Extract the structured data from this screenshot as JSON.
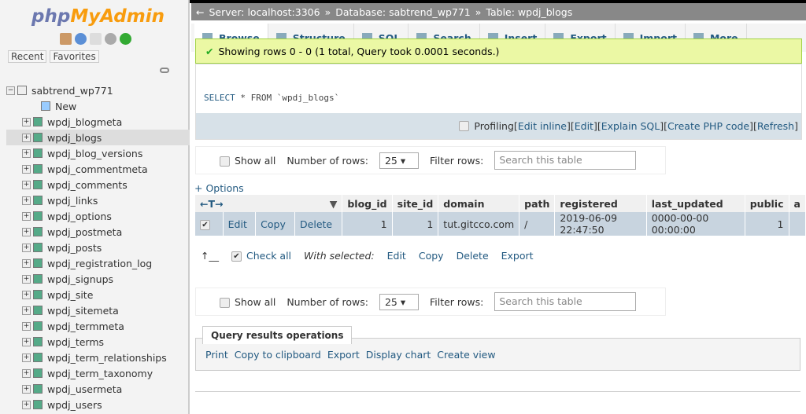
{
  "sidebar": {
    "logo_a": "php",
    "logo_b": "MyAdmin",
    "recent": "Recent",
    "favorites": "Favorites",
    "db": "sabtrend_wp771",
    "new": "New",
    "tables": [
      "wpdj_blogmeta",
      "wpdj_blogs",
      "wpdj_blog_versions",
      "wpdj_commentmeta",
      "wpdj_comments",
      "wpdj_links",
      "wpdj_options",
      "wpdj_postmeta",
      "wpdj_posts",
      "wpdj_registration_log",
      "wpdj_signups",
      "wpdj_site",
      "wpdj_sitemeta",
      "wpdj_termmeta",
      "wpdj_terms",
      "wpdj_term_relationships",
      "wpdj_term_taxonomy",
      "wpdj_usermeta",
      "wpdj_users"
    ],
    "selected": "wpdj_blogs"
  },
  "breadcrumb": {
    "server": "Server: localhost:3306",
    "database": "Database: sabtrend_wp771",
    "table": "Table: wpdj_blogs"
  },
  "tabs": [
    "Browse",
    "Structure",
    "SQL",
    "Search",
    "Insert",
    "Export",
    "Import",
    "More"
  ],
  "message": "Showing rows 0 - 0 (1 total, Query took 0.0001 seconds.)",
  "sql": {
    "select": "SELECT",
    "rest": " * FROM ",
    "table": "`wpdj_blogs`"
  },
  "profiling": {
    "label": "Profiling",
    "links": [
      "Edit inline",
      "Edit",
      "Explain SQL",
      "Create PHP code",
      "Refresh"
    ]
  },
  "nav": {
    "show_all": "Show all",
    "rows_label": "Number of rows:",
    "rows_value": "25",
    "filter_label": "Filter rows:",
    "filter_placeholder": "Search this table"
  },
  "options": "+ Options",
  "table": {
    "columns": [
      "blog_id",
      "site_id",
      "domain",
      "path",
      "registered",
      "last_updated",
      "public",
      "a"
    ],
    "rows": [
      {
        "edit": "Edit",
        "copy": "Copy",
        "delete": "Delete",
        "cells": [
          "1",
          "1",
          "tut.gitcco.com",
          "/",
          "2019-06-09 22:47:50",
          "0000-00-00 00:00:00",
          "1"
        ]
      }
    ]
  },
  "with_selected": {
    "check_all": "Check all",
    "label": "With selected:",
    "edit": "Edit",
    "copy": "Copy",
    "delete": "Delete",
    "export": "Export"
  },
  "qro": {
    "title": "Query results operations",
    "print": "Print",
    "copy": "Copy to clipboard",
    "export": "Export",
    "chart": "Display chart",
    "view": "Create view"
  }
}
